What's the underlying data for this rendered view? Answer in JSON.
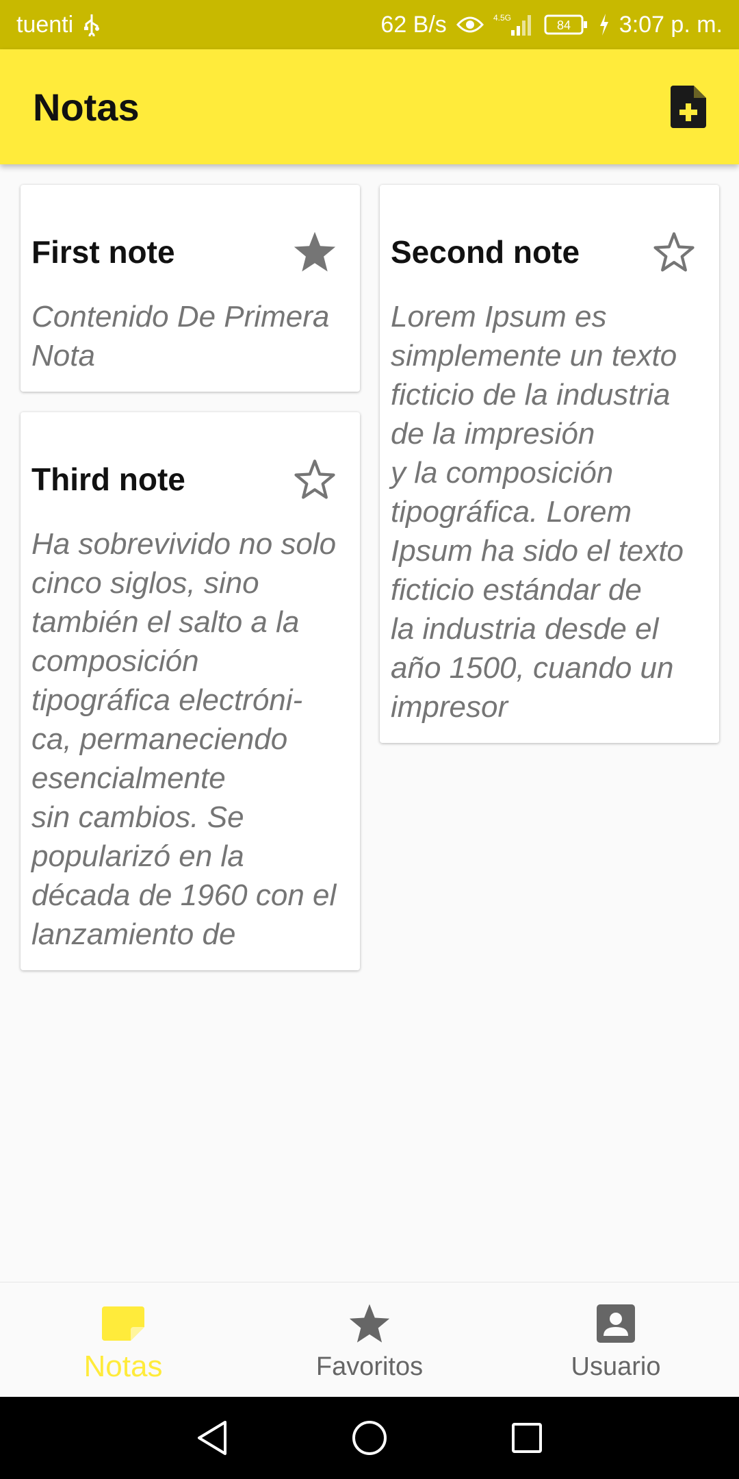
{
  "status_bar": {
    "carrier": "tuenti",
    "usb_icon": "usb-icon",
    "net_speed": "62 B/s",
    "eye_icon": "eye-icon",
    "network_type": "4.5G",
    "signal_icon": "signal-icon",
    "battery": "84",
    "charging_icon": "charging-icon",
    "time": "3:07 p. m."
  },
  "app_bar": {
    "title": "Notas",
    "add_icon": "add-note-icon",
    "background_color": "#ffeb3b"
  },
  "notes": [
    {
      "title": "First note",
      "body": "Contenido De Primera Nota",
      "favorite": true
    },
    {
      "title": "Second note",
      "body": "Lorem Ipsum es simplemente un texto ficticio de la industria de la impresión\ny la composición tipográfica. Lorem Ipsum ha sido el texto ficticio estándar de\nla industria desde el año 1500, cuando un impresor",
      "favorite": false
    },
    {
      "title": "Third note",
      "body": "Ha sobrevivido no solo cinco siglos, sino también el salto a la composición tipográfica electróni-ca, permaneciendo esencialmente\nsin cambios. Se popularizó en la década de 1960 con el lanzamiento de",
      "favorite": false
    }
  ],
  "bottom_nav": {
    "items": [
      {
        "label": "Notas",
        "icon": "note-icon",
        "active": true
      },
      {
        "label": "Favoritos",
        "icon": "star-icon",
        "active": false
      },
      {
        "label": "Usuario",
        "icon": "account-icon",
        "active": false
      }
    ],
    "active_color": "#ffeb3b"
  },
  "system_nav": {
    "back_icon": "back-icon",
    "home_icon": "home-icon",
    "recents_icon": "recents-icon"
  }
}
